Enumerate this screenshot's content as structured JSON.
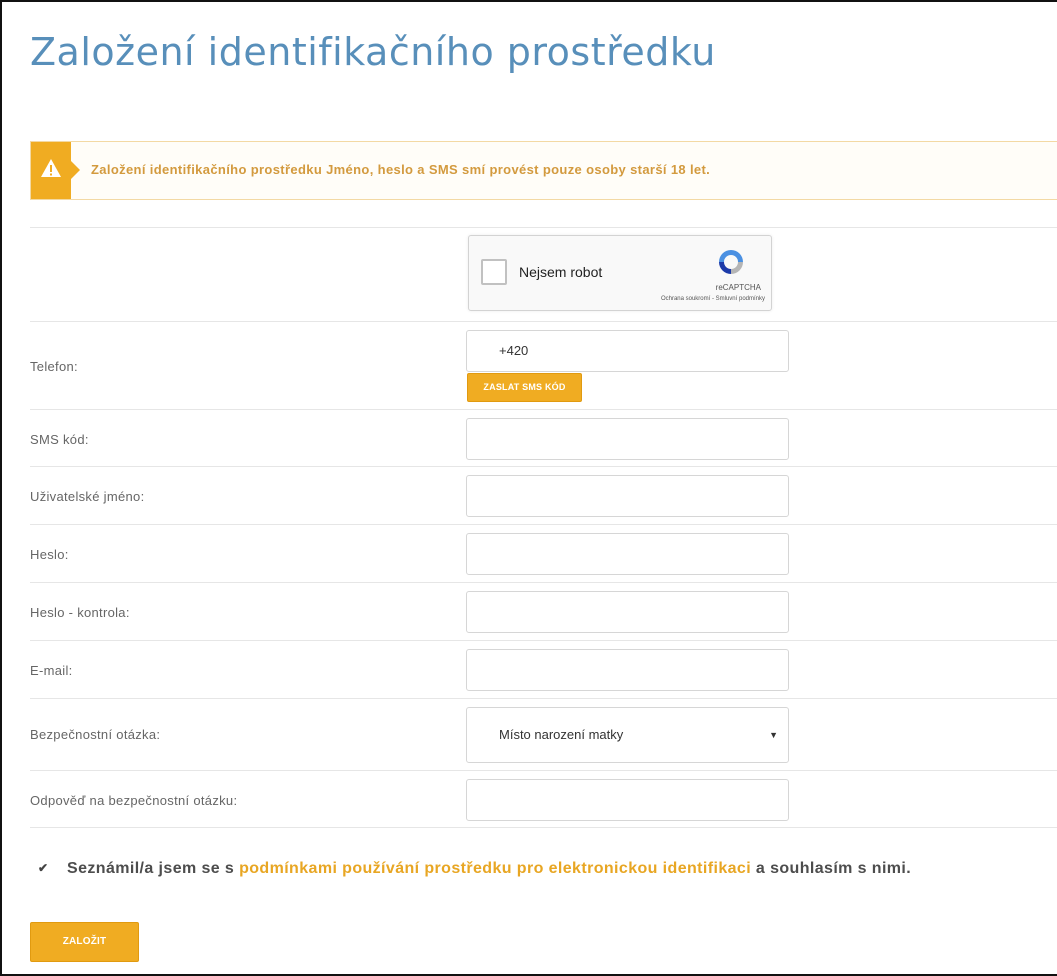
{
  "page": {
    "title": "Založení identifikačního prostředku"
  },
  "alert": {
    "icon": "warning-icon",
    "text": "Založení identifikačního prostředku Jméno, heslo a SMS smí provést pouze osoby starší 18 let."
  },
  "captcha": {
    "label": "Nejsem robot",
    "brand": "reCAPTCHA",
    "links": "Ochrana soukromí - Smluvní podmínky"
  },
  "form": {
    "phone_label": "Telefon:",
    "phone_value": "+420",
    "send_sms_button": "ZASLAT SMS KÓD",
    "sms_code_label": "SMS kód:",
    "username_label": "Uživatelské jméno:",
    "password_label": "Heslo:",
    "password_check_label": "Heslo - kontrola:",
    "email_label": "E-mail:",
    "security_question_label": "Bezpečnostní otázka:",
    "security_question_value": "Místo narození matky",
    "security_answer_label": "Odpověď na bezpečnostní otázku:"
  },
  "consent": {
    "checked": true,
    "text_before": "Seznámil/a jsem se s",
    "link_text": "podmínkami používání prostředku pro elektronickou identifikaci",
    "text_after": "a souhlasím s nimi."
  },
  "submit_button": "ZALOŽIT",
  "colors": {
    "accent": "#f0ac22",
    "title": "#4a86b5",
    "alert_text": "#d39a3e"
  }
}
